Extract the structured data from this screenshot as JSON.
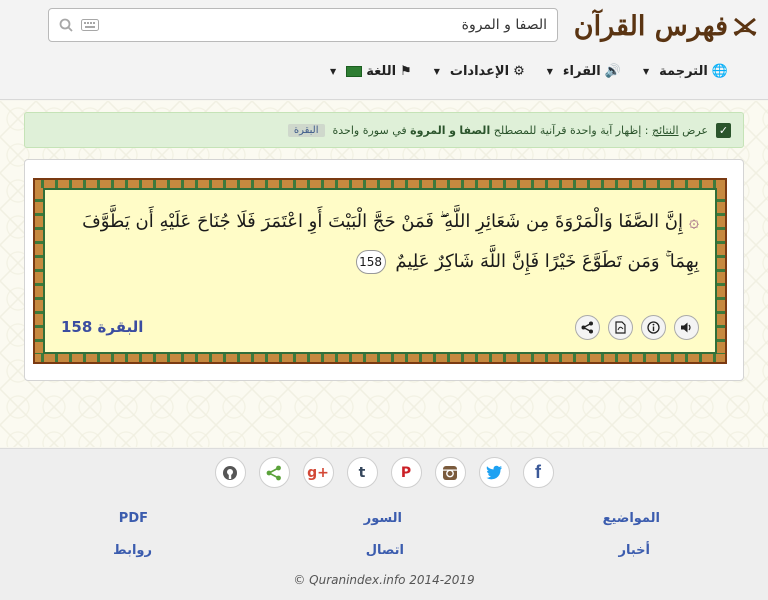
{
  "header": {
    "logo_text": "فهرس القرآن",
    "search": {
      "value": "الصفا و المروة"
    },
    "menu": [
      {
        "label": "الترجمة",
        "icon": "globe-icon"
      },
      {
        "label": "القراء",
        "icon": "volume-icon"
      },
      {
        "label": "الإعدادات",
        "icon": "gear-icon"
      },
      {
        "label": "اللغة",
        "icon": "flag-icon"
      }
    ]
  },
  "notice": {
    "prefix": "عرض",
    "results_word": "النتائج",
    "text": ": إظهار آية واحدة قرآنية للمصطلح",
    "term1": "الصفا",
    "conj": "و",
    "term2": "المروة",
    "suffix": "في سورة واحدة",
    "surah_tag": "البقرة"
  },
  "verse": {
    "text_part1": "إِنَّ الصَّفَا وَالْمَرْوَةَ مِن شَعَائِرِ اللَّهِ ۖ فَمَنْ حَجَّ الْبَيْتَ أَوِ اعْتَمَرَ فَلَا جُنَاحَ عَلَيْهِ أَن يَطَّوَّفَ بِهِمَا ۚ وَمَن تَطَوَّعَ خَيْرًا فَإِنَّ اللَّهَ شَاكِرٌ عَلِيمٌ",
    "ayah_number": "158",
    "reference": "البقرة 158"
  },
  "footer": {
    "socials": [
      "facebook-icon",
      "twitter-icon",
      "instagram-icon",
      "pinterest-icon",
      "tumblr-icon",
      "google-plus-icon",
      "share-icon",
      "github-icon"
    ],
    "links": {
      "topics": "المواضيع",
      "surahs": "السور",
      "pdf": "PDF",
      "news": "أخبار",
      "contact": "اتصال",
      "links": "روابط"
    },
    "copyright": "© Quranindex.info 2014-2019"
  },
  "colors": {
    "logo": "#5a3412",
    "notice_bg": "#dff0d8",
    "link": "#3b5cae",
    "verse_bg": "#fffcc7"
  }
}
